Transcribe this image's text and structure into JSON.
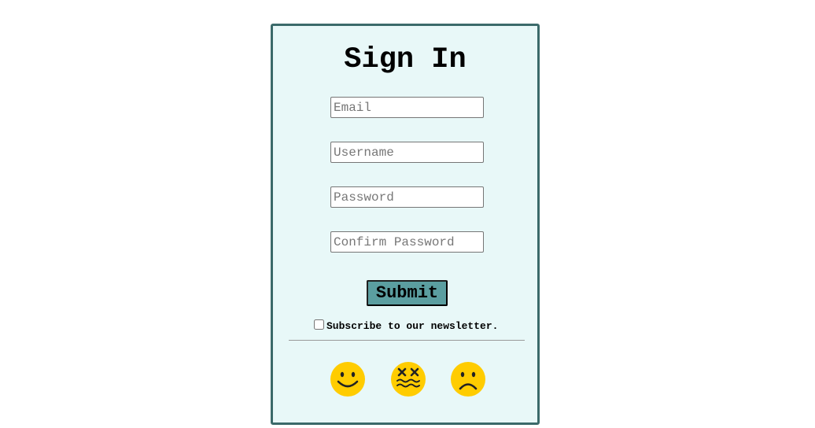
{
  "form": {
    "title": "Sign In",
    "fields": {
      "email": {
        "placeholder": "Email",
        "value": ""
      },
      "username": {
        "placeholder": "Username",
        "value": ""
      },
      "password": {
        "placeholder": "Password",
        "value": ""
      },
      "confirm_password": {
        "placeholder": "Confirm Password",
        "value": ""
      }
    },
    "submit_label": "Submit",
    "newsletter": {
      "label": "Subscribe to our newsletter.",
      "checked": false
    }
  },
  "emojis": [
    {
      "icon": "smiling-face-icon"
    },
    {
      "icon": "dizzy-face-icon"
    },
    {
      "icon": "frowning-face-icon"
    }
  ],
  "colors": {
    "card_background": "#e8f8f8",
    "card_border": "#3b6a6a",
    "submit_background": "#5b9ea0",
    "emoji_fill": "#ffcc00"
  }
}
